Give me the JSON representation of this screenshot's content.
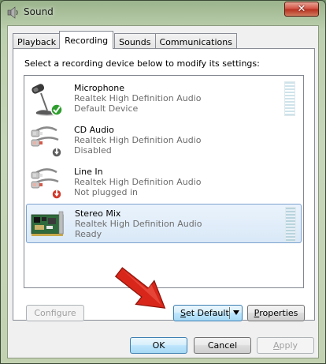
{
  "window": {
    "title": "Sound",
    "close_label": "✕"
  },
  "tabs": [
    {
      "label": "Playback",
      "active": false
    },
    {
      "label": "Recording",
      "active": true
    },
    {
      "label": "Sounds",
      "active": false
    },
    {
      "label": "Communications",
      "active": false
    }
  ],
  "instruction": "Select a recording device below to modify its settings:",
  "devices": [
    {
      "name": "Microphone",
      "driver": "Realtek High Definition Audio",
      "status": "Default Device",
      "icon": "microphone-icon",
      "badge": "green-check",
      "selected": false
    },
    {
      "name": "CD Audio",
      "driver": "Realtek High Definition Audio",
      "status": "Disabled",
      "icon": "rca-cable-icon",
      "badge": "grey-down-arrow",
      "selected": false
    },
    {
      "name": "Line In",
      "driver": "Realtek High Definition Audio",
      "status": "Not plugged in",
      "icon": "rca-cable-icon",
      "badge": "red-down-arrow",
      "selected": false
    },
    {
      "name": "Stereo Mix",
      "driver": "Realtek High Definition Audio",
      "status": "Ready",
      "icon": "sound-card-icon",
      "badge": "none",
      "selected": true
    }
  ],
  "buttons": {
    "configure": "Configure",
    "set_default_pre": "",
    "set_default_u": "S",
    "set_default_post": "et Default",
    "properties_pre": "",
    "properties_u": "P",
    "properties_post": "roperties",
    "ok": "OK",
    "cancel": "Cancel",
    "apply_pre": "",
    "apply_u": "A",
    "apply_post": "pply"
  },
  "colors": {
    "selection_border": "#7da2ce",
    "annotation_arrow": "#d8261b",
    "status_ok": "#2f9e2f",
    "status_unplugged": "#d2392b"
  }
}
